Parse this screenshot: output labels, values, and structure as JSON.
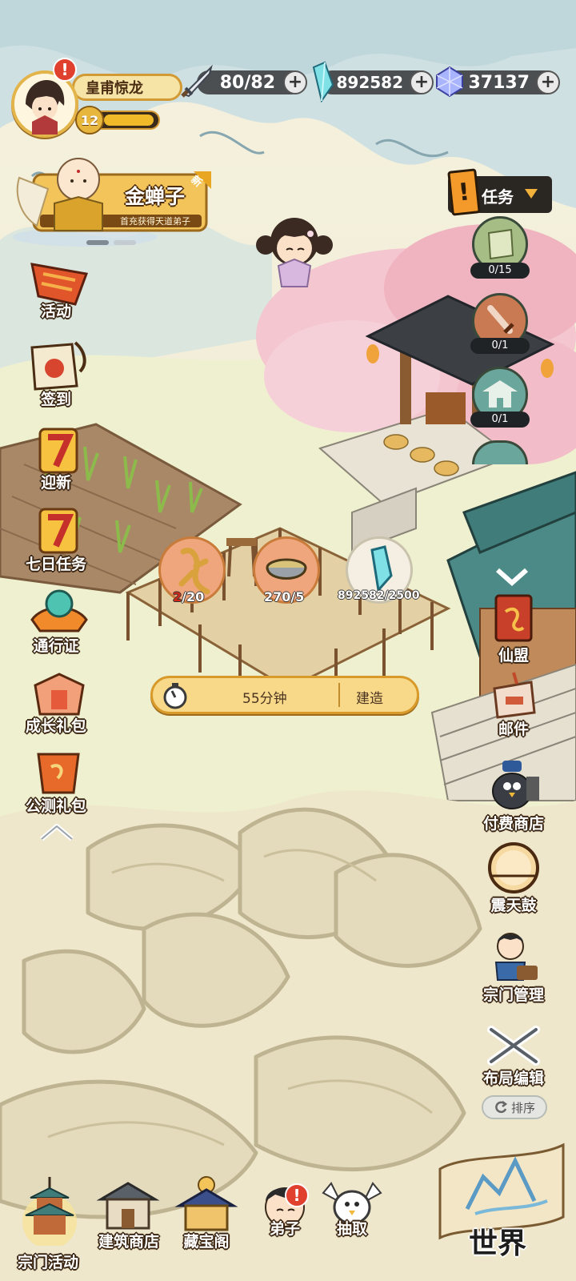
{
  "player": {
    "name": "皇甫惊龙",
    "level": "12",
    "alert_mark": "!"
  },
  "resources": {
    "stamina": "80/82",
    "crystal": "892582",
    "gem": "37137",
    "plus": "+"
  },
  "promo": {
    "name": "金蝉子",
    "tag": "新",
    "caption": "首充获得天道弟子"
  },
  "left_menu": [
    {
      "label": "活动"
    },
    {
      "label": "签到"
    },
    {
      "label": "迎新"
    },
    {
      "label": "七日任务"
    },
    {
      "label": "通行证"
    },
    {
      "label": "成长礼包"
    },
    {
      "label": "公测礼包"
    }
  ],
  "quest": {
    "label": "任务",
    "alert_mark": "!",
    "items": [
      {
        "count": "0/15"
      },
      {
        "count": "0/1"
      },
      {
        "count": "0/1"
      }
    ]
  },
  "right_menu": [
    {
      "label": "仙盟"
    },
    {
      "label": "邮件"
    },
    {
      "label": "付费商店"
    },
    {
      "label": "震天鼓"
    },
    {
      "label": "宗门管理"
    },
    {
      "label": "布局编辑"
    }
  ],
  "sort_button": "排序",
  "construction": {
    "requirements": [
      {
        "have": "2",
        "need": "/20",
        "have_color": "#d02a1a"
      },
      {
        "have": "270",
        "need": "/5",
        "have_color": "#ffffff"
      },
      {
        "have": "892582",
        "need": "/2500",
        "have_color": "#ffffff"
      }
    ],
    "time": "55分钟",
    "build_label": "建造"
  },
  "bottom_nav": [
    {
      "label": "宗门活动"
    },
    {
      "label": "建筑商店"
    },
    {
      "label": "藏宝阁"
    },
    {
      "label": "弟子"
    },
    {
      "label": "抽取"
    }
  ],
  "bottom_alert_mark": "!",
  "world_label": "世界",
  "colors": {
    "accent_gold": "#d19a34",
    "alert_red": "#e0402e",
    "cherry_pink": "#f2b6c2",
    "roof_teal": "#3f7c7a"
  }
}
